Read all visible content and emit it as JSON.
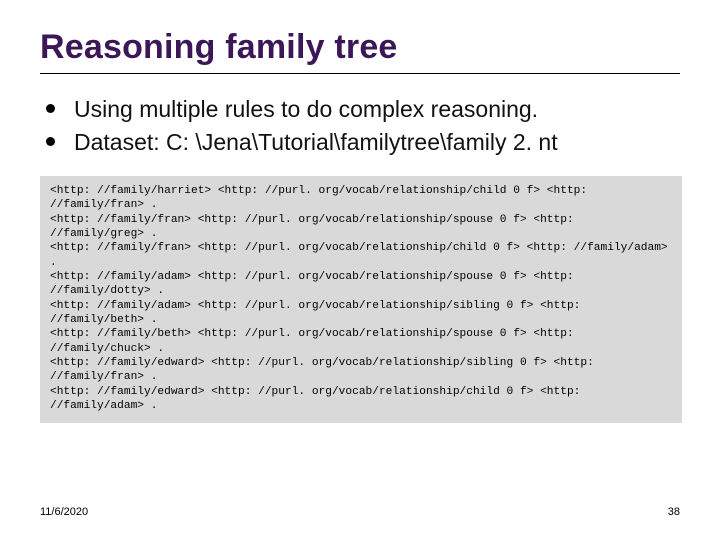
{
  "slide": {
    "title": "Reasoning family tree",
    "bullets": [
      "Using multiple rules to do complex reasoning.",
      "Dataset: C: \\Jena\\Tutorial\\familytree\\family 2. nt"
    ],
    "code": "<http: //family/harriet> <http: //purl. org/vocab/relationship/child 0 f> <http: //family/fran> .\n<http: //family/fran> <http: //purl. org/vocab/relationship/spouse 0 f> <http: //family/greg> .\n<http: //family/fran> <http: //purl. org/vocab/relationship/child 0 f> <http: //family/adam> .\n<http: //family/adam> <http: //purl. org/vocab/relationship/spouse 0 f> <http: //family/dotty> .\n<http: //family/adam> <http: //purl. org/vocab/relationship/sibling 0 f> <http: //family/beth> .\n<http: //family/beth> <http: //purl. org/vocab/relationship/spouse 0 f> <http: //family/chuck> .\n<http: //family/edward> <http: //purl. org/vocab/relationship/sibling 0 f> <http: //family/fran> .\n<http: //family/edward> <http: //purl. org/vocab/relationship/child 0 f> <http: //family/adam> .",
    "footer": {
      "date": "11/6/2020",
      "page": "38"
    }
  }
}
